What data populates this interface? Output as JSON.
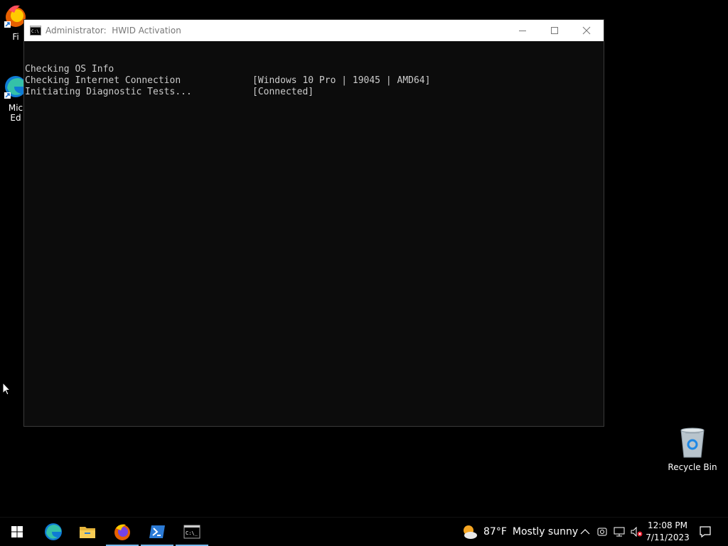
{
  "desktop": {
    "icons": [
      {
        "label": "Fi"
      },
      {
        "label": "Mic\nEd"
      },
      {
        "label": "Recycle Bin"
      }
    ]
  },
  "window": {
    "title_user": "Administrator:",
    "title_app": "HWID Activation",
    "lines": [
      {
        "left": "Checking OS Info",
        "right": "[Windows 10 Pro | 19045 | AMD64]"
      },
      {
        "left": "Checking Internet Connection",
        "right": "[Connected]"
      },
      {
        "left": "Initiating Diagnostic Tests...",
        "right": ""
      }
    ],
    "background": "#0c0c0c",
    "text_color": "#cccccc"
  },
  "taskbar": {
    "pinned": [
      "windows-start",
      "edge",
      "file-explorer",
      "firefox",
      "powershell",
      "command-prompt"
    ],
    "weather": {
      "temp": "87°F",
      "condition": "Mostly sunny"
    },
    "clock": {
      "time": "12:08 PM",
      "date": "7/11/2023"
    },
    "accent": "#76b9ed"
  }
}
